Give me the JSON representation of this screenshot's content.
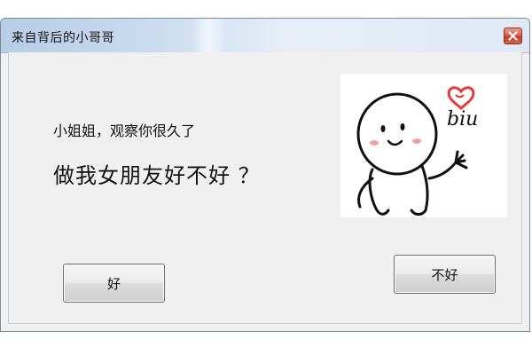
{
  "window": {
    "title": "来自背后的小哥哥"
  },
  "message": {
    "line1": "小姐姐，观察你很久了",
    "line2": "做我女朋友好不好 ？"
  },
  "image": {
    "caption": "biu",
    "icon": "heart-icon"
  },
  "buttons": {
    "yes_label": "好",
    "no_label": "不好"
  },
  "colors": {
    "titlebar": "#c7d9ee",
    "close_button": "#d3654d",
    "dialog_background": "#f0f0f0",
    "heart": "#e23b3b",
    "cheeks": "#f4a0a0"
  }
}
